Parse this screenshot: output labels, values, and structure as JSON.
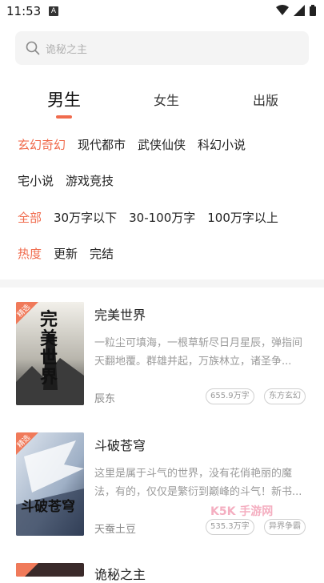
{
  "status": {
    "time": "11:53",
    "notif": "A"
  },
  "search": {
    "placeholder": "诡秘之主"
  },
  "tabs": [
    {
      "label": "男生",
      "active": true
    },
    {
      "label": "女生",
      "active": false
    },
    {
      "label": "出版",
      "active": false
    }
  ],
  "filters": {
    "genres": [
      "玄幻奇幻",
      "现代都市",
      "武侠仙侠",
      "科幻小说",
      "宅小说",
      "游戏竞技"
    ],
    "words": [
      "全部",
      "30万字以下",
      "30-100万字",
      "100万字以上"
    ],
    "status": [
      "热度",
      "更新",
      "完结"
    ]
  },
  "books": [
    {
      "badge": "精选",
      "cover_text": "完美世界",
      "title": "完美世界",
      "desc": "一粒尘可填海，一根草斩尽日月星辰，弹指间天翻地覆。群雄并起，万族林立，诸圣争...",
      "author": "辰东",
      "words": "655.9万字",
      "category": "东方玄幻"
    },
    {
      "badge": "精选",
      "cover_text": "斗破苍穹",
      "title": "斗破苍穹",
      "desc": "这里是属于斗气的世界，没有花俏艳丽的魔法，有的，仅仅是繁衍到巅峰的斗气！新书...",
      "author": "天蚕土豆",
      "words": "535.3万字",
      "category": "异界争霸"
    },
    {
      "badge": "精选",
      "title": "诡秘之主"
    }
  ],
  "watermark": "K5K 手游网",
  "colors": {
    "accent": "#f06b4d",
    "badge": "#f07a5a"
  }
}
